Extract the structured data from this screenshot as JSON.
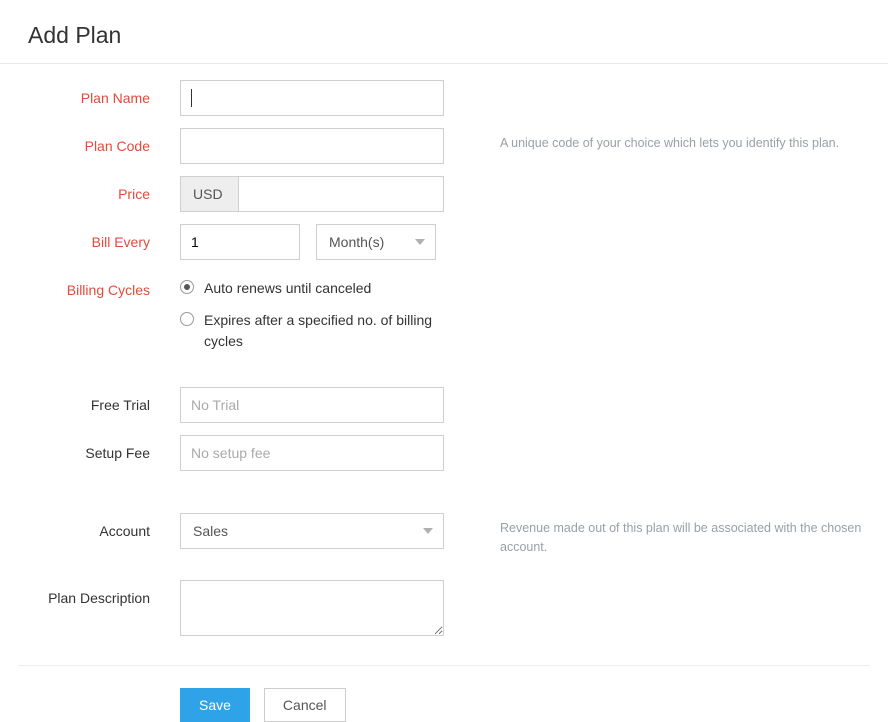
{
  "header": {
    "title": "Add Plan"
  },
  "labels": {
    "plan_name": "Plan Name",
    "plan_code": "Plan Code",
    "price": "Price",
    "bill_every": "Bill Every",
    "billing_cycles": "Billing Cycles",
    "free_trial": "Free Trial",
    "setup_fee": "Setup Fee",
    "account": "Account",
    "plan_description": "Plan Description"
  },
  "fields": {
    "plan_name": "",
    "plan_code": "",
    "currency": "USD",
    "price": "",
    "bill_every_value": "1",
    "bill_every_unit": "Month(s)",
    "billing_cycles_options": {
      "auto": "Auto renews until canceled",
      "expires": "Expires after a specified no. of billing cycles"
    },
    "billing_cycles_selected": "auto",
    "free_trial_placeholder": "No Trial",
    "setup_fee_placeholder": "No setup fee",
    "account": "Sales",
    "plan_description": ""
  },
  "help": {
    "plan_code": "A unique code of your choice which lets you identify this plan.",
    "account": "Revenue made out of this plan will be associated with the chosen account."
  },
  "buttons": {
    "save": "Save",
    "cancel": "Cancel"
  }
}
